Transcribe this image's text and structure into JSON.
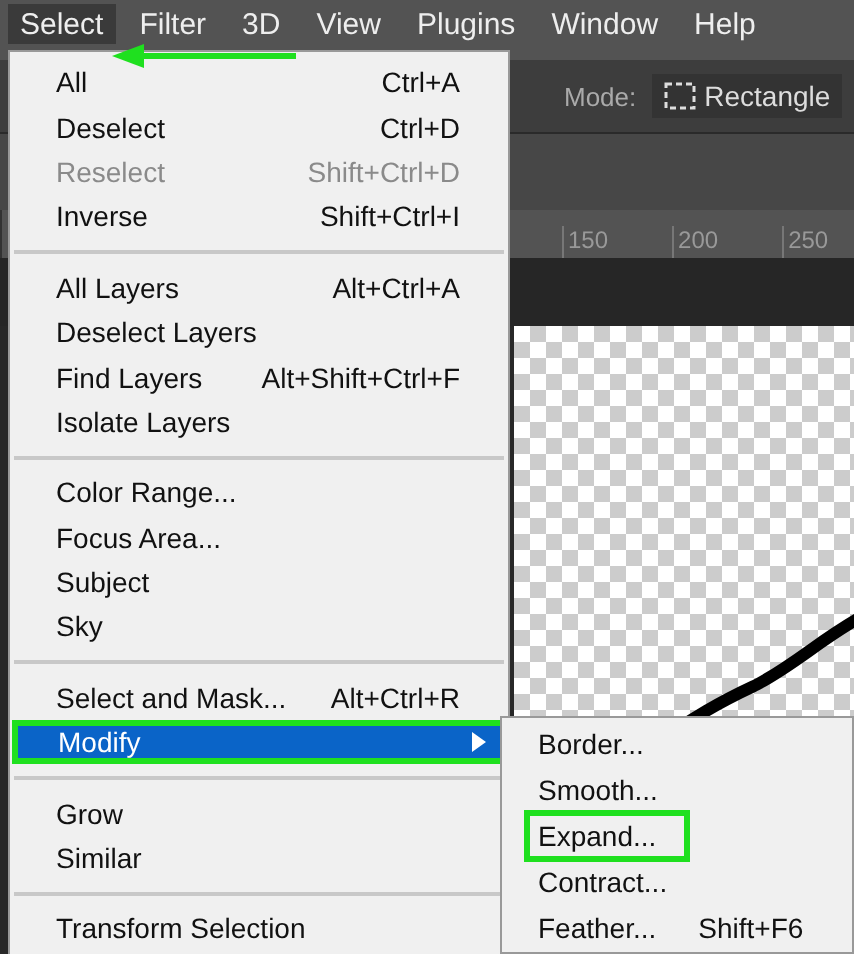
{
  "menu_bar": [
    {
      "label": "Select",
      "selected": true
    },
    {
      "label": "Filter",
      "selected": false
    },
    {
      "label": "3D",
      "selected": false
    },
    {
      "label": "View",
      "selected": false
    },
    {
      "label": "Plugins",
      "selected": false
    },
    {
      "label": "Window",
      "selected": false
    },
    {
      "label": "Help",
      "selected": false
    }
  ],
  "options_bar": {
    "mode_label": "Mode:",
    "mode_value": "Rectangle"
  },
  "ruler": [
    "150",
    "200",
    "250"
  ],
  "menu": [
    {
      "kind": "item",
      "label": "All",
      "shortcut": "Ctrl+A",
      "disabled": false,
      "selected": false
    },
    {
      "kind": "item",
      "label": "Deselect",
      "shortcut": "Ctrl+D",
      "disabled": false,
      "selected": false
    },
    {
      "kind": "item",
      "label": "Reselect",
      "shortcut": "Shift+Ctrl+D",
      "disabled": true,
      "selected": false
    },
    {
      "kind": "item",
      "label": "Inverse",
      "shortcut": "Shift+Ctrl+I",
      "disabled": false,
      "selected": false
    },
    {
      "kind": "separator"
    },
    {
      "kind": "item",
      "label": "All Layers",
      "shortcut": "Alt+Ctrl+A",
      "disabled": false,
      "selected": false
    },
    {
      "kind": "item",
      "label": "Deselect Layers",
      "disabled": false,
      "selected": false
    },
    {
      "kind": "item",
      "label": "Find Layers",
      "shortcut": "Alt+Shift+Ctrl+F",
      "disabled": false,
      "selected": false
    },
    {
      "kind": "item",
      "label": "Isolate Layers",
      "disabled": false,
      "selected": false
    },
    {
      "kind": "separator"
    },
    {
      "kind": "item",
      "label": "Color Range...",
      "disabled": false,
      "selected": false
    },
    {
      "kind": "item",
      "label": "Focus Area...",
      "disabled": false,
      "selected": false
    },
    {
      "kind": "item",
      "label": "Subject",
      "disabled": false,
      "selected": false
    },
    {
      "kind": "item",
      "label": "Sky",
      "disabled": false,
      "selected": false
    },
    {
      "kind": "separator"
    },
    {
      "kind": "item",
      "label": "Select and Mask...",
      "shortcut": "Alt+Ctrl+R",
      "disabled": false,
      "selected": false
    },
    {
      "kind": "submenu",
      "label": "Modify",
      "disabled": false,
      "selected": true,
      "outlined": true
    },
    {
      "kind": "separator"
    },
    {
      "kind": "item",
      "label": "Grow",
      "disabled": false,
      "selected": false
    },
    {
      "kind": "item",
      "label": "Similar",
      "disabled": false,
      "selected": false
    },
    {
      "kind": "separator"
    },
    {
      "kind": "item",
      "label": "Transform Selection",
      "disabled": false,
      "selected": false
    }
  ],
  "submenu": [
    {
      "label": "Border...",
      "outlined": false
    },
    {
      "label": "Smooth...",
      "outlined": false
    },
    {
      "label": "Expand...",
      "outlined": true
    },
    {
      "label": "Contract...",
      "outlined": false
    },
    {
      "label": "Feather...",
      "shortcut": "Shift+F6",
      "outlined": false
    }
  ]
}
